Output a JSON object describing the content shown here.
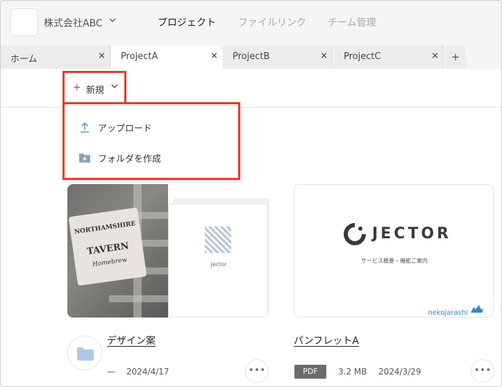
{
  "header": {
    "company": "株式会社ABC",
    "nav": [
      "プロジェクト",
      "ファイルリンク",
      "チーム管理"
    ]
  },
  "tabs": [
    {
      "label": "ホーム"
    },
    {
      "label": "ProjectA"
    },
    {
      "label": "ProjectB"
    },
    {
      "label": "ProjectC"
    }
  ],
  "tab_close": "×",
  "tab_add": "+",
  "toolbar": {
    "new_label": "新規",
    "new_plus": "+"
  },
  "dropdown": {
    "items": [
      {
        "label": "アップロード",
        "icon": "upload-icon"
      },
      {
        "label": "フォルダを作成",
        "icon": "folder-add-icon"
      }
    ]
  },
  "cards": [
    {
      "title": "デザイン案",
      "meta_left": "—",
      "date": "2024/4/17",
      "thumb": {
        "sign_lines": [
          "NORTHAMSHIRE",
          "TAVERN",
          "Homebrew"
        ],
        "doc_brand": "Jector"
      }
    },
    {
      "title": "パンフレットA",
      "badge": "PDF",
      "size": "3.2 MB",
      "date": "2024/3/29",
      "thumb": {
        "brand": "JECTOR",
        "subtitle": "サービス概要・機能ご案内",
        "footer": "nekojarashi"
      }
    }
  ],
  "more": "•••",
  "colors": {
    "highlight": "#e53d26",
    "folder": "#a9c8e8",
    "link": "#2a8ad1"
  }
}
